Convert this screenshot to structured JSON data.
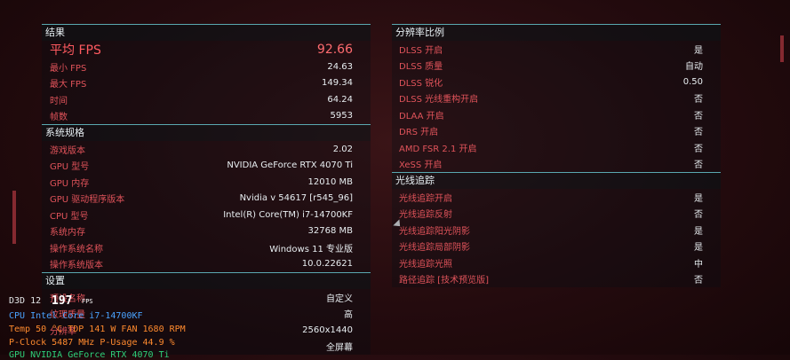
{
  "results": {
    "title": "结果",
    "rows": [
      {
        "label": "平均 FPS",
        "value": "92.66",
        "big": true
      },
      {
        "label": "最小 FPS",
        "value": "24.63"
      },
      {
        "label": "最大 FPS",
        "value": "149.34"
      },
      {
        "label": "时间",
        "value": "64.24"
      },
      {
        "label": "帧数",
        "value": "5953"
      }
    ]
  },
  "system": {
    "title": "系统规格",
    "rows": [
      {
        "label": "游戏版本",
        "value": "2.02"
      },
      {
        "label": "GPU 型号",
        "value": "NVIDIA GeForce RTX 4070 Ti"
      },
      {
        "label": "GPU 内存",
        "value": "12010 MB"
      },
      {
        "label": "GPU 驱动程序版本",
        "value": "Nvidia v 54617 [r545_96]"
      },
      {
        "label": "CPU 型号",
        "value": "Intel(R) Core(TM) i7-14700KF"
      },
      {
        "label": "系统内存",
        "value": "32768 MB"
      },
      {
        "label": "操作系统名称",
        "value": "Windows 11 专业版"
      },
      {
        "label": "操作系统版本",
        "value": "10.0.22621"
      }
    ]
  },
  "settings": {
    "title": "设置",
    "rows": [
      {
        "label": "预设名称",
        "value": "自定义"
      },
      {
        "label": "纹理质量",
        "value": "高"
      },
      {
        "label": "分辨率",
        "value": "2560x1440"
      },
      {
        "label": "",
        "value": "全屏幕"
      }
    ]
  },
  "resolution_scaling": {
    "title": "分辨率比例",
    "rows": [
      {
        "label": "DLSS 开启",
        "value": "是"
      },
      {
        "label": "DLSS 质量",
        "value": "自动"
      },
      {
        "label": "DLSS 锐化",
        "value": "0.50"
      },
      {
        "label": "DLSS 光线重构开启",
        "value": "否"
      },
      {
        "label": "DLAA 开启",
        "value": "否"
      },
      {
        "label": "DRS 开启",
        "value": "否"
      },
      {
        "label": "AMD FSR 2.1 开启",
        "value": "否"
      },
      {
        "label": "XeSS 开启",
        "value": "否"
      }
    ]
  },
  "ray_tracing": {
    "title": "光线追踪",
    "rows": [
      {
        "label": "光线追踪开启",
        "value": "是"
      },
      {
        "label": "光线追踪反射",
        "value": "否"
      },
      {
        "label": "光线追踪阳光阴影",
        "value": "是"
      },
      {
        "label": "光线追踪局部阴影",
        "value": "是"
      },
      {
        "label": "光线追踪光照",
        "value": "中"
      },
      {
        "label": "路径追踪 [技术预览版]",
        "value": "否"
      }
    ]
  },
  "overlay": {
    "d3d": "D3D 12",
    "fps": "197",
    "fps_unit": "FPS",
    "cpu_line": "CPU  Intel Core i7-14700KF",
    "temp_line": "Temp  50 °C  TDP 141 W  FAN 1680 RPM",
    "clock_line": "P-Clock 5487 MHz  P-Usage 44.9 %",
    "gpu_line": "GPU  NVIDIA GeForce RTX 4070 Ti"
  }
}
